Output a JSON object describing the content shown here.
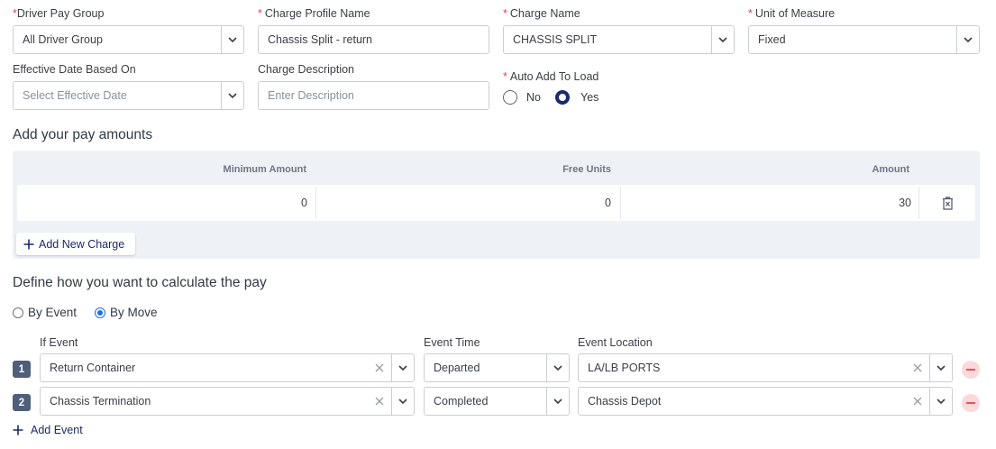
{
  "form": {
    "driver_pay_group": {
      "required_mark": "*",
      "label": "Driver Pay Group",
      "value": "All Driver Group"
    },
    "charge_profile_name": {
      "required_mark": "*",
      "label": "Charge Profile Name",
      "value": "Chassis Split - return"
    },
    "charge_name": {
      "required_mark": "*",
      "label": "Charge Name",
      "value": "CHASSIS SPLIT"
    },
    "unit_of_measure": {
      "required_mark": "*",
      "label": "Unit of Measure",
      "value": "Fixed"
    },
    "effective_date": {
      "label": "Effective Date Based On",
      "placeholder": "Select Effective Date"
    },
    "charge_description": {
      "label": "Charge Description",
      "placeholder": "Enter Description"
    },
    "auto_add_to_load": {
      "required_mark": "*",
      "label": "Auto Add To Load",
      "options": [
        "No",
        "Yes"
      ],
      "selected": "Yes"
    }
  },
  "pay_amounts": {
    "title": "Add your pay amounts",
    "columns": [
      "Minimum Amount",
      "Free Units",
      "Amount"
    ],
    "rows": [
      {
        "minimum_amount": "0",
        "free_units": "0",
        "amount": "30"
      }
    ],
    "add_button": "Add New Charge"
  },
  "calculation": {
    "title": "Define how you want to calculate the pay",
    "modes": [
      "By Event",
      "By Move"
    ],
    "selected_mode": "By Move",
    "columns": {
      "if_event": "If Event",
      "event_time": "Event Time",
      "event_location": "Event Location"
    },
    "events": [
      {
        "index": "1",
        "event": "Return Container",
        "time": "Departed",
        "location": "LA/LB PORTS"
      },
      {
        "index": "2",
        "event": "Chassis Termination",
        "time": "Completed",
        "location": "Chassis Depot"
      }
    ],
    "add_event": "Add Event"
  },
  "colors": {
    "accent": "#1b2a6b",
    "required": "#e0464f",
    "radio_selected": "#1e6fe0",
    "remove": "#e4525a",
    "badge": "#4f5f79"
  }
}
